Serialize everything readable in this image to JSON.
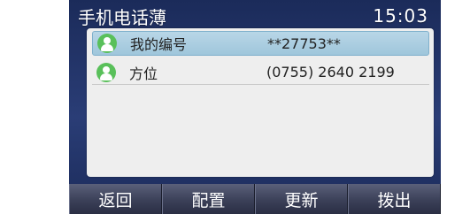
{
  "header": {
    "title": "手机电话薄",
    "time": "15:03"
  },
  "contacts": [
    {
      "name": "我的编号",
      "number": "**27753**",
      "selected": true
    },
    {
      "name": "方位",
      "number": "(0755) 2640 2199",
      "selected": false
    }
  ],
  "softkeys": [
    "返回",
    "配置",
    "更新",
    "拨出"
  ]
}
